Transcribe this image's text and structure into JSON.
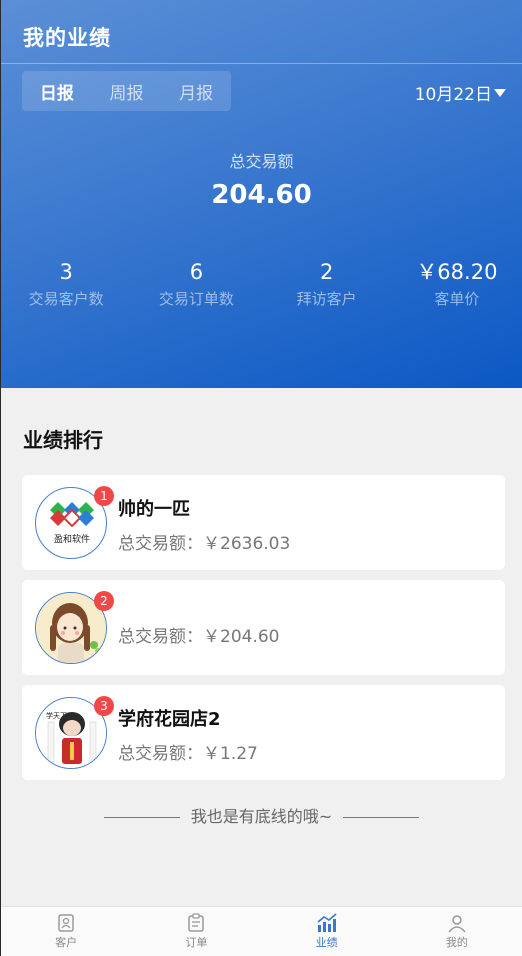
{
  "header": {
    "title": "我的业绩",
    "tabs": [
      {
        "label": "日报",
        "active": true
      },
      {
        "label": "周报",
        "active": false
      },
      {
        "label": "月报",
        "active": false
      }
    ],
    "date": "10月22日"
  },
  "summary": {
    "total_label": "总交易额",
    "total_value": "204.60",
    "stats": [
      {
        "value": "3",
        "label": "交易客户数"
      },
      {
        "value": "6",
        "label": "交易订单数"
      },
      {
        "value": "2",
        "label": "拜访客户"
      },
      {
        "value": "￥68.20",
        "label": "客单价"
      }
    ]
  },
  "ranking": {
    "title": "业绩排行",
    "items": [
      {
        "rank": "1",
        "name": "帅的一匹",
        "amount": "总交易额：￥2636.03",
        "avatar": "logo-avatar"
      },
      {
        "rank": "2",
        "name": "",
        "amount": "总交易额：￥204.60",
        "avatar": "girl-avatar"
      },
      {
        "rank": "3",
        "name": "学府花园店2",
        "amount": "总交易额：￥1.27",
        "avatar": "meme-avatar"
      }
    ],
    "avatar_logo_text": "盈和软件",
    "avatar_meme_text": "学天下男"
  },
  "footer_note": "我也是有底线的哦~",
  "tabbar": [
    {
      "label": "客户",
      "icon": "customer-icon",
      "active": false
    },
    {
      "label": "订单",
      "icon": "order-icon",
      "active": false
    },
    {
      "label": "业绩",
      "icon": "chart-icon",
      "active": true
    },
    {
      "label": "我的",
      "icon": "user-icon",
      "active": false
    }
  ],
  "colors": {
    "primary": "#3a78cf",
    "badge": "#f04848"
  }
}
